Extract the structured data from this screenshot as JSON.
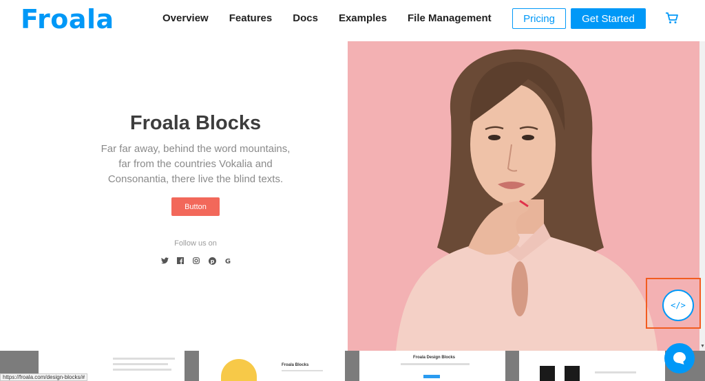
{
  "header": {
    "logo": "Froala",
    "nav": [
      "Overview",
      "Features",
      "Docs",
      "Examples",
      "File Management"
    ],
    "pricing_label": "Pricing",
    "get_started_label": "Get Started",
    "cart_icon": "cart-icon"
  },
  "hero": {
    "title": "Froala Blocks",
    "text": "Far far away, behind the word mountains, far from the countries Vokalia and Consonantia, there live the blind texts.",
    "button_label": "Button",
    "follow_label": "Follow us on",
    "socials": [
      "twitter-icon",
      "facebook-icon",
      "instagram-icon",
      "pinterest-icon",
      "google-icon"
    ]
  },
  "photo": {
    "background": "#f3b1b3",
    "subject": "portrait-photo"
  },
  "code_toggle": {
    "icon": "code-icon",
    "glyph": "</>"
  },
  "strip": {
    "thumb_titles": [
      "Froala Blocks",
      "Froala Design Blocks"
    ]
  },
  "status_bar": {
    "url": "https://froala.com/design-blocks/#"
  },
  "colors": {
    "brand": "#0098f7",
    "button": "#f2685a",
    "highlight_frame": "#f25c1f"
  }
}
